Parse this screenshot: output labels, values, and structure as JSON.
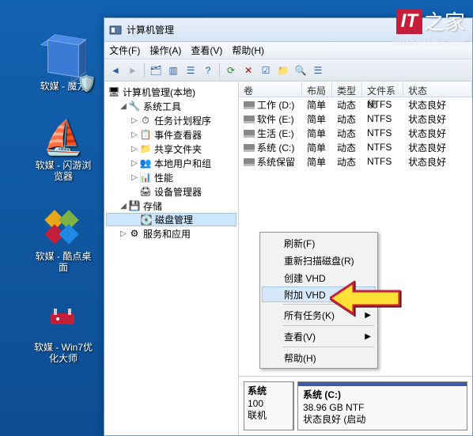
{
  "desktop": {
    "items": [
      {
        "label": "软媒 - 魔方"
      },
      {
        "label": "软媒 - 闪游浏览器"
      },
      {
        "label": "软媒 - 酷点桌面"
      },
      {
        "label": "软媒 - Win7优化大师"
      }
    ]
  },
  "watermark": {
    "it": "IT",
    "zhi": "之家",
    "url": "www.ithome.com"
  },
  "window": {
    "title": "计算机管理",
    "menu": {
      "file": "文件(F)",
      "action": "操作(A)",
      "view": "查看(V)",
      "help": "帮助(H)"
    },
    "tree": {
      "root": "计算机管理(本地)",
      "sys": "系统工具",
      "sched": "任务计划程序",
      "evt": "事件查看器",
      "share": "共享文件夹",
      "users": "本地用户和组",
      "perf": "性能",
      "devmgr": "设备管理器",
      "storage": "存储",
      "diskmgr": "磁盘管理",
      "svc": "服务和应用"
    },
    "columns": {
      "vol": "卷",
      "layout": "布局",
      "type": "类型",
      "fs": "文件系统",
      "status": "状态"
    },
    "volumes": [
      {
        "name": "工作 (D:)",
        "layout": "简单",
        "type": "动态",
        "fs": "NTFS",
        "status": "状态良好"
      },
      {
        "name": "软件 (E:)",
        "layout": "简单",
        "type": "动态",
        "fs": "NTFS",
        "status": "状态良好"
      },
      {
        "name": "生活 (E:)",
        "layout": "简单",
        "type": "动态",
        "fs": "NTFS",
        "status": "状态良好"
      },
      {
        "name": "系统 (C:)",
        "layout": "简单",
        "type": "动态",
        "fs": "NTFS",
        "status": "状态良好"
      },
      {
        "name": "系统保留",
        "layout": "简单",
        "type": "动态",
        "fs": "NTFS",
        "status": "状态良好"
      }
    ],
    "graphic": {
      "box0": {
        "l1": "系统",
        "l2": "100",
        "l3": "联机"
      },
      "box1": {
        "l1": "系统 (C:)",
        "l2": "38.96 GB NTF",
        "l3": "状态良好 (启动"
      }
    }
  },
  "context": {
    "refresh": "刷新(F)",
    "rescan": "重新扫描磁盘(R)",
    "create": "创建 VHD",
    "attach": "附加 VHD",
    "alltasks": "所有任务(K)",
    "view": "查看(V)",
    "help": "帮助(H)"
  }
}
